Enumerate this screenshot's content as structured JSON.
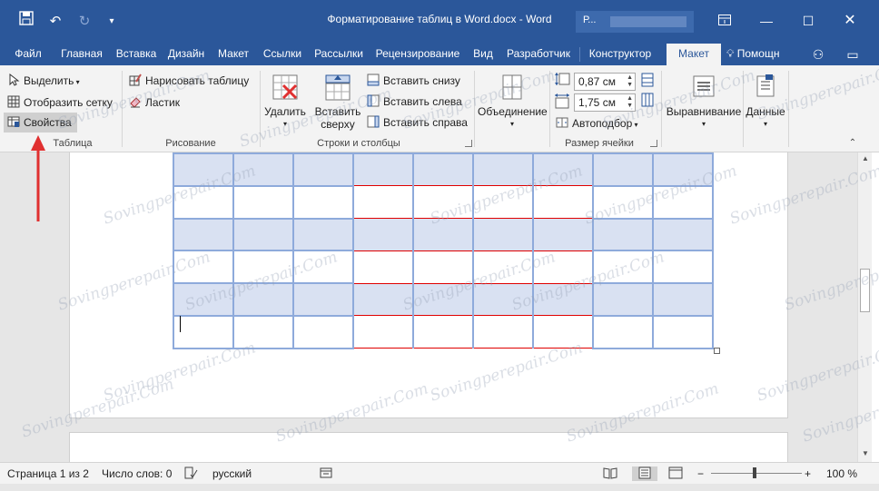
{
  "window": {
    "title": "Форматирование таблиц в Word.docx - Word",
    "account_initial": "Р...",
    "quick_access": [
      "save-icon",
      "undo-icon",
      "redo-icon",
      "customize-icon"
    ],
    "controls": [
      "ribbon-display-icon",
      "minimize-icon",
      "maximize-icon",
      "close-icon"
    ]
  },
  "tabs": {
    "items": [
      "Файл",
      "Главная",
      "Вставка",
      "Дизайн",
      "Макет",
      "Ссылки",
      "Рассылки",
      "Рецензирование",
      "Вид",
      "Разработчик",
      "Конструктор",
      "Макет"
    ],
    "active_index": 11,
    "tell_me": "Помощн"
  },
  "ribbon": {
    "table_group": {
      "label": "Таблица",
      "select": "Выделить",
      "show_grid": "Отобразить сетку",
      "properties": "Свойства"
    },
    "draw_group": {
      "label": "Рисование",
      "draw_table": "Нарисовать таблицу",
      "eraser": "Ластик"
    },
    "rows_cols_group": {
      "label": "Строки и столбцы",
      "delete": "Удалить",
      "insert_above_1": "Вставить",
      "insert_above_2": "сверху",
      "insert_below": "Вставить снизу",
      "insert_left": "Вставить слева",
      "insert_right": "Вставить справа"
    },
    "merge_group": {
      "merge": "Объединение"
    },
    "cell_size_group": {
      "label": "Размер ячейки",
      "height": "0,87 см",
      "width": "1,75 см",
      "autofit": "Автоподбор"
    },
    "alignment": "Выравнивание",
    "data": "Данные"
  },
  "table": {
    "rows": 6,
    "cols": 9,
    "shaded_rows": [
      0,
      2,
      4
    ],
    "red_cols": [
      3,
      4,
      5,
      6
    ]
  },
  "statusbar": {
    "page": "Страница 1 из 2",
    "words": "Число слов: 0",
    "language": "русский",
    "zoom": "100 %"
  },
  "watermark": "Sovingperepair.Com",
  "colors": {
    "title_bar": "#2b579a",
    "ribbon_bg": "#f3f3f3",
    "table_border": "#8eaadb",
    "table_shade": "#d9e1f2",
    "red_border": "#e00000",
    "arrow": "#e03030"
  }
}
